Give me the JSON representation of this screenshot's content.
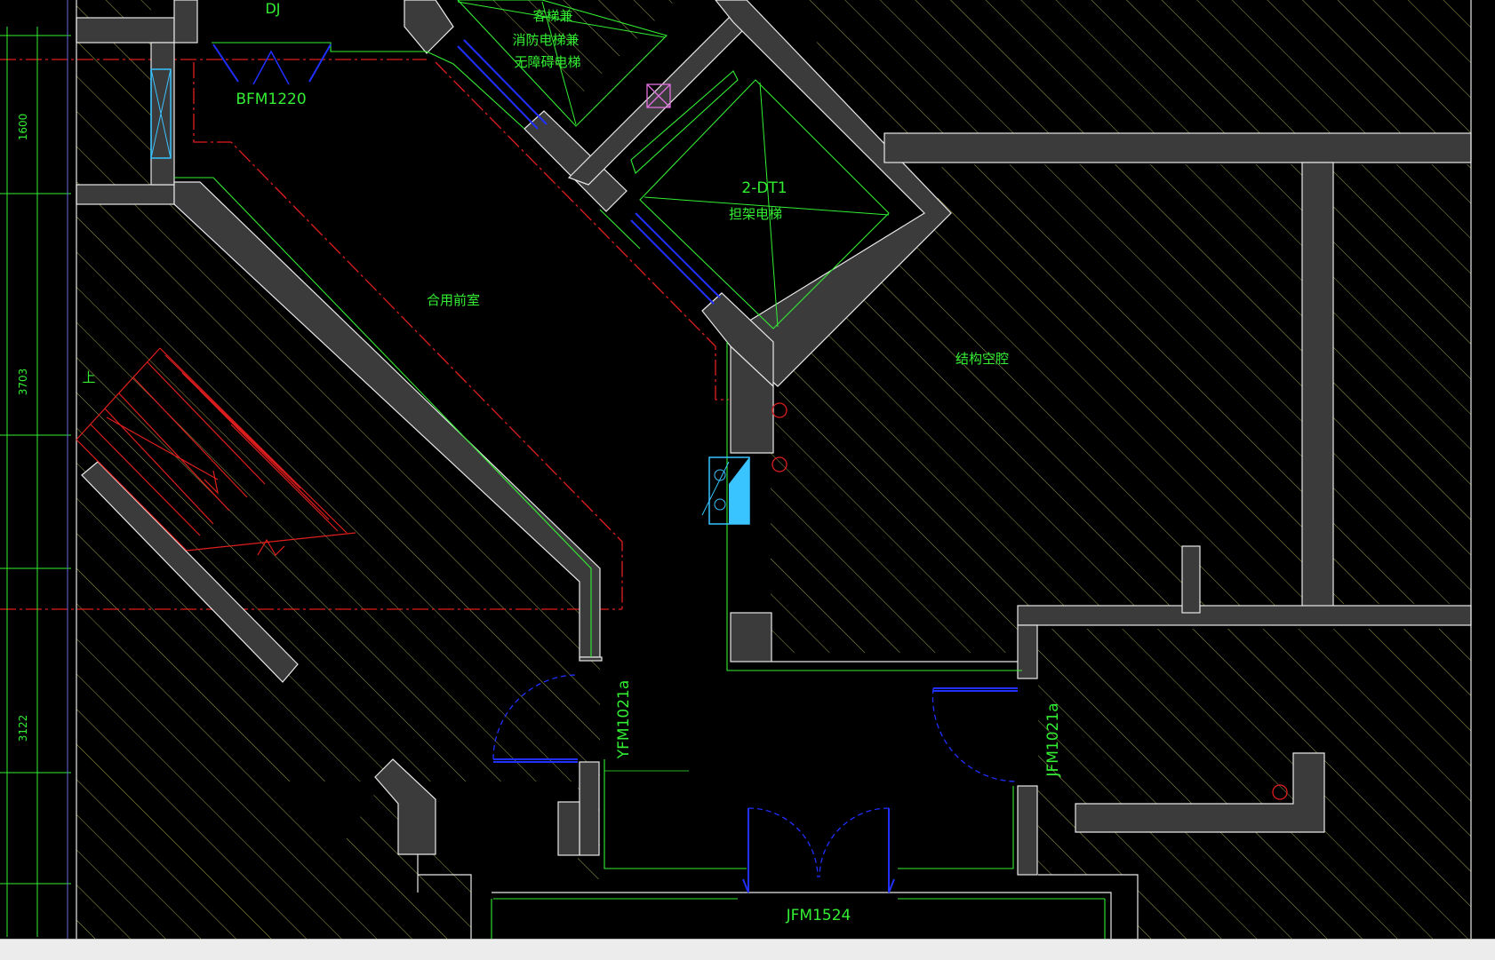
{
  "colors": {
    "background": "#000000",
    "wall_fill": "#3b3b3b",
    "wall_edge": "#e8e8e8",
    "hatch": "#c8c864",
    "green": "#33ee33",
    "red": "#e01e1e",
    "blue": "#1a22dd",
    "cyan": "#39c3ff",
    "magenta": "#e070e0"
  },
  "labels": {
    "door_dj": "DJ",
    "door_bfm1220": "BFM1220",
    "stair_up": "上",
    "elev_passenger": "客梯兼",
    "elev_fire": "消防电梯兼",
    "elev_accessible": "无障碍电梯",
    "stretcher_code": "2-DT1",
    "stretcher_name": "担架电梯",
    "shared_lobby": "合用前室",
    "structural_void": "结构空腔",
    "door_yfm_left": "YFM1021a",
    "door_yfm_right": "JFM1021a",
    "door_jfm1524": "JFM1524"
  },
  "dimensions": {
    "top": "1600",
    "middle": "3703",
    "bottom": "3122"
  },
  "icons": {
    "hydrant": "fire-hydrant-cabinet-icon",
    "riser": "pipe-riser-circle-icon",
    "vent": "vent-x-icon"
  }
}
